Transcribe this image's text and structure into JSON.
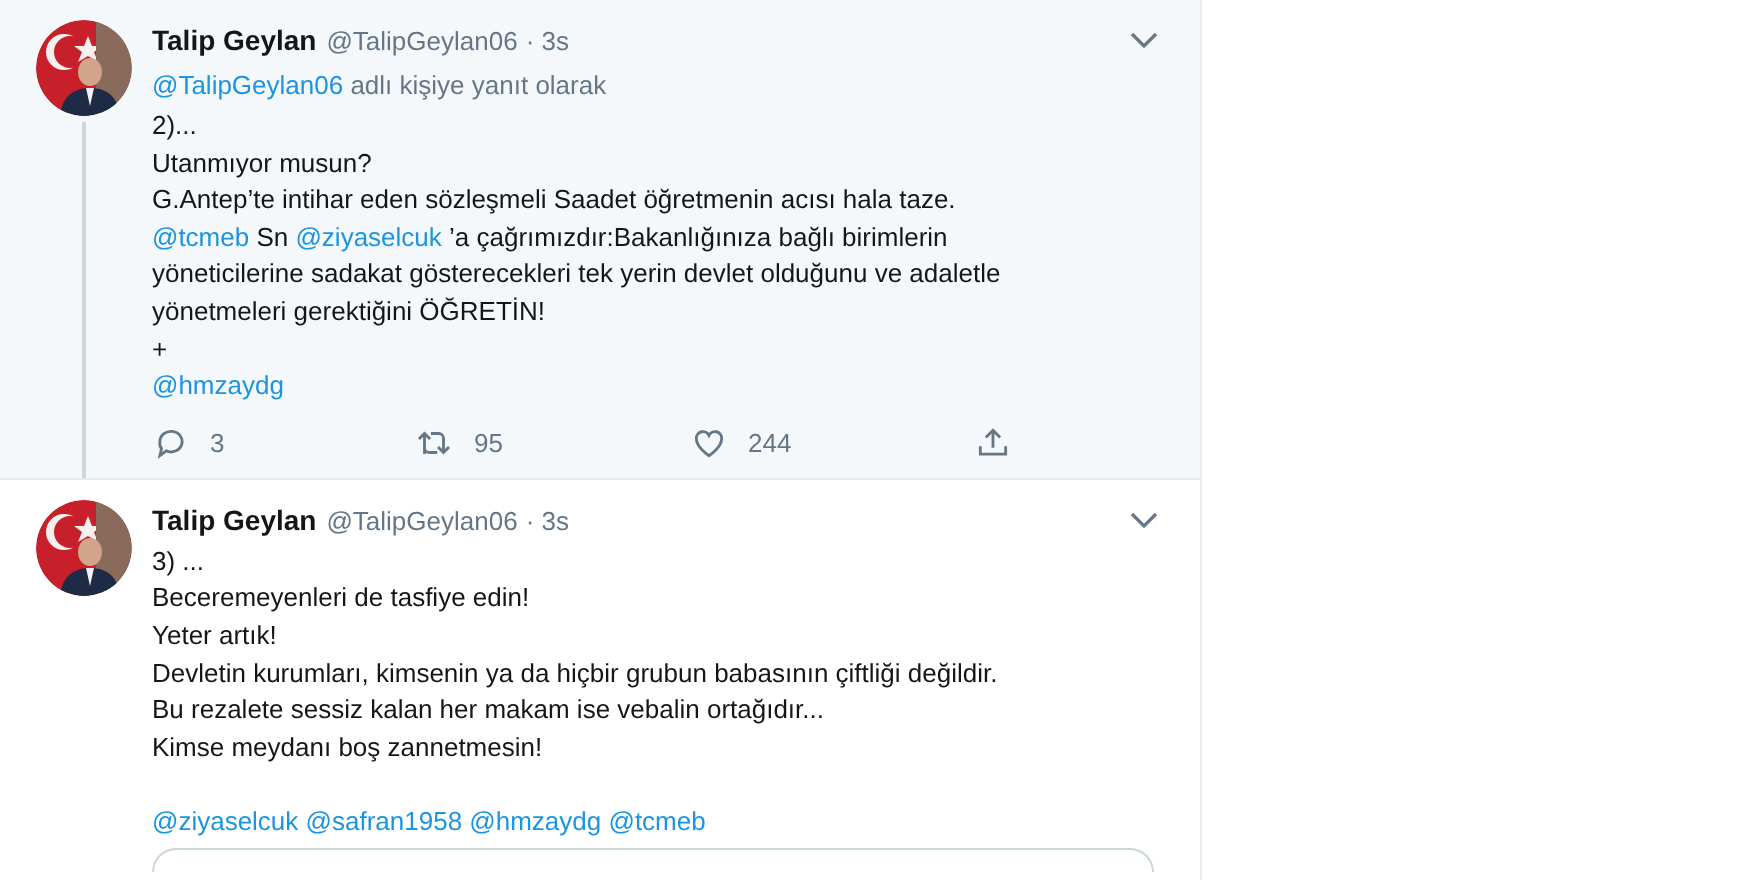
{
  "tweets": [
    {
      "name": "Talip Geylan",
      "handle": "@TalipGeylan06",
      "time": "· 3s",
      "hovered": true,
      "thread_line": true,
      "reply_to": {
        "mention": "@TalipGeylan06",
        "text": "adlı kişiye yanıt olarak"
      },
      "lines": [
        [
          {
            "kind": "text",
            "text": "2)..."
          }
        ],
        [
          {
            "kind": "text",
            "text": "Utanmıyor musun?"
          }
        ],
        [
          {
            "kind": "text",
            "text": "G.Antep’te intihar eden sözleşmeli Saadet öğretmenin acısı hala taze."
          }
        ],
        [
          {
            "kind": "mention",
            "text": "@tcmeb"
          },
          {
            "kind": "text",
            "text": " Sn "
          },
          {
            "kind": "mention",
            "text": "@ziyaselcuk"
          },
          {
            "kind": "text",
            "text": " ’a çağrımızdır:Bakanlığınıza bağlı birimlerin"
          }
        ],
        [
          {
            "kind": "text",
            "text": "yöneticilerine sadakat gösterecekleri tek yerin devlet olduğunu ve adaletle"
          }
        ],
        [
          {
            "kind": "text",
            "text": "yönetmeleri gerektiğini ÖĞRETİN!"
          }
        ],
        [
          {
            "kind": "text",
            "text": "+"
          }
        ],
        [
          {
            "kind": "mention",
            "text": "@hmzaydg"
          }
        ]
      ],
      "actions": {
        "replies": "3",
        "retweets": "95",
        "likes": "244"
      }
    },
    {
      "name": "Talip Geylan",
      "handle": "@TalipGeylan06",
      "time": "· 3s",
      "hovered": false,
      "thread_line": false,
      "lines": [
        [
          {
            "kind": "text",
            "text": "3) ..."
          }
        ],
        [
          {
            "kind": "text",
            "text": "Beceremeyenleri de tasfiye edin!"
          }
        ],
        [
          {
            "kind": "text",
            "text": "Yeter artık!"
          }
        ],
        [
          {
            "kind": "text",
            "text": "Devletin kurumları, kimsenin ya da hiçbir grubun babasının çiftliği değildir."
          }
        ],
        [
          {
            "kind": "text",
            "text": "Bu rezalete sessiz kalan her makam ise vebalin ortağıdır..."
          }
        ],
        [
          {
            "kind": "text",
            "text": "Kimse meydanı boş zannetmesin!"
          }
        ],
        [
          {
            "kind": "blank"
          }
        ],
        [
          {
            "kind": "mention",
            "text": "@ziyaselcuk"
          },
          {
            "kind": "space"
          },
          {
            "kind": "mention",
            "text": "@safran1958"
          },
          {
            "kind": "space"
          },
          {
            "kind": "mention",
            "text": "@hmzaydg"
          },
          {
            "kind": "space"
          },
          {
            "kind": "mention",
            "text": "@tcmeb"
          }
        ]
      ],
      "card_below": true
    }
  ]
}
